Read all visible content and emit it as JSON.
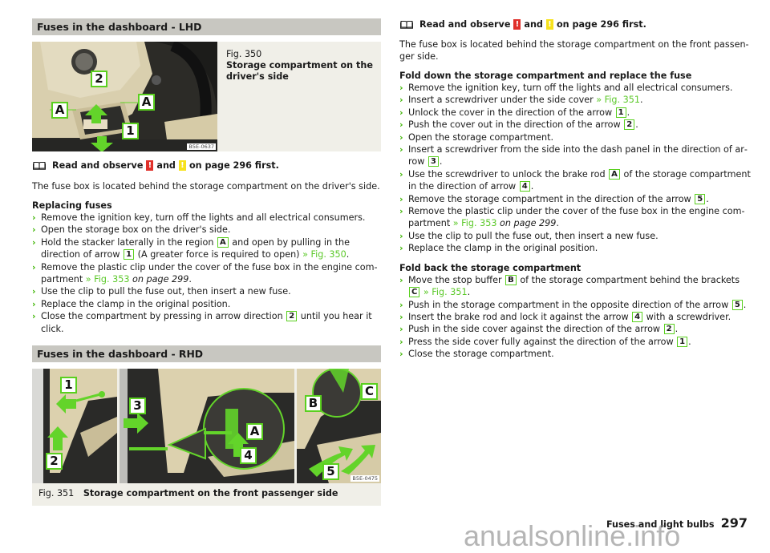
{
  "left": {
    "section1": {
      "heading": "Fuses in the dashboard - LHD",
      "figure": {
        "number": "Fig. 350",
        "title": "Storage compartment on the driver's side",
        "image_code": "B5E-0637",
        "labels": [
          "2",
          "A",
          "A",
          "1"
        ]
      },
      "read_notice": {
        "prefix": "Read and observe",
        "red_mark": "!",
        "middle": "and",
        "yellow_mark": "!",
        "suffix": "on page 296 first."
      },
      "intro": "The fuse box is located behind the storage compartment on the driver's side.",
      "subheading": "Replacing fuses",
      "steps": [
        {
          "parts": [
            {
              "t": "Remove the ignition key, turn off the lights and all electrical consumers."
            }
          ]
        },
        {
          "parts": [
            {
              "t": "Open the storage box on the driver's side."
            }
          ]
        },
        {
          "parts": [
            {
              "t": "Hold the stacker laterally in the region "
            },
            {
              "tag": "A"
            },
            {
              "t": " and open by pulling in the direction of arrow "
            },
            {
              "tag": "1"
            },
            {
              "t": " (A greater force is required to open) "
            },
            {
              "link": "» Fig. 350"
            },
            {
              "t": "."
            }
          ]
        },
        {
          "parts": [
            {
              "t": "Remove the plastic clip under the cover of the fuse box in the engine com­partment "
            },
            {
              "link": "» Fig. 353"
            },
            {
              "t": " "
            },
            {
              "ital": "on page 299"
            },
            {
              "t": "."
            }
          ]
        },
        {
          "parts": [
            {
              "t": "Use the clip to pull the fuse out, then insert a new fuse."
            }
          ]
        },
        {
          "parts": [
            {
              "t": "Replace the clamp in the original position."
            }
          ]
        },
        {
          "parts": [
            {
              "t": "Close the compartment by pressing in arrow direction "
            },
            {
              "tag": "2"
            },
            {
              "t": " until you hear it click."
            }
          ]
        }
      ]
    },
    "section2": {
      "heading": "Fuses in the dashboard - RHD",
      "figure": {
        "number": "Fig. 351",
        "title": "Storage compartment on the front passenger side",
        "image_code": "B5E-0475",
        "labels": [
          "1",
          "2",
          "3",
          "4",
          "A",
          "B",
          "C",
          "5"
        ]
      }
    }
  },
  "right": {
    "read_notice": {
      "prefix": "Read and observe",
      "red_mark": "!",
      "middle": "and",
      "yellow_mark": "!",
      "suffix": "on page 296 first."
    },
    "intro": "The fuse box is located behind the storage compartment on the front passen­ger side.",
    "subheading1": "Fold down the storage compartment and replace the fuse",
    "steps1": [
      {
        "parts": [
          {
            "t": "Remove the ignition key, turn off the lights and all electrical consumers."
          }
        ]
      },
      {
        "parts": [
          {
            "t": "Insert a screwdriver under the side cover "
          },
          {
            "link": "» Fig. 351"
          },
          {
            "t": "."
          }
        ]
      },
      {
        "parts": [
          {
            "t": "Unlock the cover in the direction of the arrow "
          },
          {
            "tag": "1"
          },
          {
            "t": "."
          }
        ]
      },
      {
        "parts": [
          {
            "t": "Push the cover out in the direction of the arrow "
          },
          {
            "tag": "2"
          },
          {
            "t": "."
          }
        ]
      },
      {
        "parts": [
          {
            "t": "Open the storage compartment."
          }
        ]
      },
      {
        "parts": [
          {
            "t": "Insert a screwdriver from the side into the dash panel in the direction of ar­row "
          },
          {
            "tag": "3"
          },
          {
            "t": "."
          }
        ]
      },
      {
        "parts": [
          {
            "t": "Use the screwdriver to unlock the brake rod "
          },
          {
            "tag": "A"
          },
          {
            "t": " of the storage compartment in the direction of arrow "
          },
          {
            "tag": "4"
          },
          {
            "t": "."
          }
        ]
      },
      {
        "parts": [
          {
            "t": "Remove the storage compartment in the direction of the arrow "
          },
          {
            "tag": "5"
          },
          {
            "t": "."
          }
        ]
      },
      {
        "parts": [
          {
            "t": "Remove the plastic clip under the cover of the fuse box in the engine com­partment "
          },
          {
            "link": "» Fig. 353"
          },
          {
            "t": " "
          },
          {
            "ital": "on page 299"
          },
          {
            "t": "."
          }
        ]
      },
      {
        "parts": [
          {
            "t": "Use the clip to pull the fuse out, then insert a new fuse."
          }
        ]
      },
      {
        "parts": [
          {
            "t": "Replace the clamp in the original position."
          }
        ]
      }
    ],
    "subheading2": "Fold back the storage compartment",
    "steps2": [
      {
        "parts": [
          {
            "t": "Move the stop buffer "
          },
          {
            "tag": "B"
          },
          {
            "t": " of the storage compartment behind the brackets "
          },
          {
            "tag": "C"
          },
          {
            "t": " "
          },
          {
            "link": "» Fig. 351"
          },
          {
            "t": "."
          }
        ]
      },
      {
        "parts": [
          {
            "t": "Push in the storage compartment in the opposite direction of the arrow "
          },
          {
            "tag": "5"
          },
          {
            "t": "."
          }
        ]
      },
      {
        "parts": [
          {
            "t": "Insert the brake rod and lock it against the arrow "
          },
          {
            "tag": "4"
          },
          {
            "t": " with a screwdriver."
          }
        ]
      },
      {
        "parts": [
          {
            "t": "Push in the side cover against the direction of the arrow "
          },
          {
            "tag": "2"
          },
          {
            "t": "."
          }
        ]
      },
      {
        "parts": [
          {
            "t": "Press the side cover fully against the direction of the arrow "
          },
          {
            "tag": "1"
          },
          {
            "t": "."
          }
        ]
      },
      {
        "parts": [
          {
            "t": "Close the storage compartment."
          }
        ]
      }
    ]
  },
  "footer": {
    "section_name": "Fuses and light bulbs",
    "page_number": "297",
    "watermark": "anualsonline.info"
  },
  "colors": {
    "accent_green": "#5ad01f",
    "link_green": "#5cc92a",
    "warning_red": "#e0302a",
    "warning_yellow": "#f7e21c",
    "heading_bg": "#c8c7c1",
    "figure_bg": "#f0efe8"
  }
}
